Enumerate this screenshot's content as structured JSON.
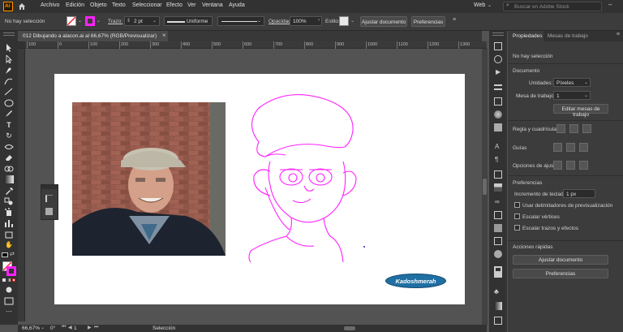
{
  "app": {
    "logo": "Ai",
    "workspace": "Web",
    "search_placeholder": "Buscar en Adobe Stock"
  },
  "menu": [
    "Archivo",
    "Edición",
    "Objeto",
    "Texto",
    "Seleccionar",
    "Efecto",
    "Ver",
    "Ventana",
    "Ayuda"
  ],
  "control_bar": {
    "selection": "No hay selección",
    "stroke_label": "Trazo:",
    "stroke_value": "2 pt",
    "brush_profile": "Uniforme",
    "opacity_label": "Opacidad:",
    "opacity_value": "100%",
    "style_label": "Estilo:",
    "adjust_doc": "Ajustar documento",
    "preferences": "Preferencias"
  },
  "document_tab": {
    "title": "012 Dibujando a alacon.ai al 66,67% (RGB/Previsualizar)",
    "close": "×"
  },
  "ruler_marks": [
    "100",
    "0",
    "100",
    "200",
    "300",
    "400",
    "500",
    "600",
    "700",
    "800",
    "900",
    "1000",
    "1100",
    "1200",
    "1300",
    "1400"
  ],
  "artboard": {
    "watermark": "Kadoshmerah"
  },
  "status": {
    "zoom": "66,67%",
    "angle": "0°",
    "artboard_num": "1",
    "tool": "Selección"
  },
  "panel": {
    "tabs": [
      "Propiedades",
      "Mesas de trabajo"
    ],
    "no_selection": "No hay selección",
    "document_title": "Documento",
    "units_label": "Unidades:",
    "units_value": "Píxeles",
    "artboard_label": "Mesa de trabajo:",
    "artboard_value": "1",
    "edit_artboards": "Editar mesas de trabajo",
    "rulers_grids": "Regla y cuadrículas",
    "guides": "Guías",
    "snap_options": "Opciones de ajuste",
    "preferences_title": "Preferencias",
    "keyboard_inc_label": "Incremento de teclado:",
    "keyboard_inc_value": "1 px",
    "checkboxes": [
      "Usar delimitadores de previsualización",
      "Escalar vértices",
      "Escalar trazos y efectos"
    ],
    "quick_actions": "Acciones rápidas",
    "adjust_doc_btn": "Ajustar documento",
    "preferences_btn": "Preferencias"
  },
  "colors": {
    "accent_stroke": "#ff22ff",
    "panel_bg": "#3c3c3c",
    "badge": "#1f6fa3"
  }
}
